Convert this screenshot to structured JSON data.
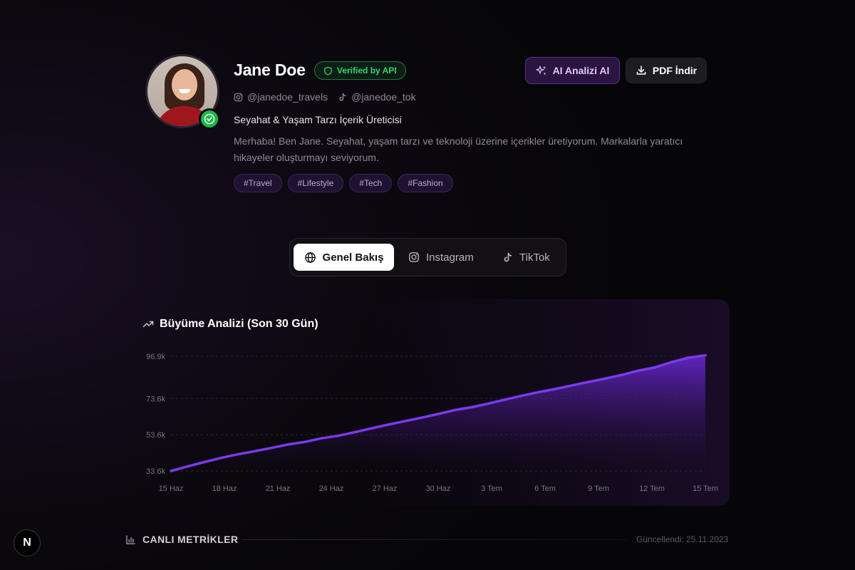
{
  "profile": {
    "name": "Jane Doe",
    "verified_badge": "Verified by API",
    "instagram_handle": "@janedoe_travels",
    "tiktok_handle": "@janedoe_tok",
    "role": "Seyahat & Yaşam Tarzı İçerik Üreticisi",
    "bio": "Merhaba! Ben Jane. Seyahat, yaşam tarzı ve teknoloji üzerine içerikler üretiyorum. Markalarla yaratıcı hikayeler oluşturmayı seviyorum.",
    "tags": [
      "#Travel",
      "#Lifestyle",
      "#Tech",
      "#Fashion"
    ]
  },
  "actions": {
    "ai_label": "AI Analizi Al",
    "pdf_label": "PDF İndir"
  },
  "tabs": [
    {
      "label": "Genel Bakış",
      "icon": "globe-icon",
      "active": true
    },
    {
      "label": "Instagram",
      "icon": "instagram-icon",
      "active": false
    },
    {
      "label": "TikTok",
      "icon": "tiktok-icon",
      "active": false
    }
  ],
  "growth": {
    "title": "Büyüme Analizi (Son 30 Gün)"
  },
  "chart_data": {
    "type": "area",
    "title": "Büyüme Analizi (Son 30 Gün)",
    "x_ticks": [
      "15 Haz",
      "18 Haz",
      "21 Haz",
      "24 Haz",
      "27 Haz",
      "30 Haz",
      "3 Tem",
      "6 Tem",
      "9 Tem",
      "12 Tem",
      "15 Tem"
    ],
    "y_ticks": [
      "33.6k",
      "53.6k",
      "73.6k",
      "96.9k"
    ],
    "y_tick_values": [
      33600,
      53600,
      73600,
      96900
    ],
    "ylim": [
      33600,
      96900
    ],
    "series": [
      {
        "values": [
          33600,
          36100,
          38500,
          40800,
          42800,
          44500,
          46300,
          48200,
          49600,
          51600,
          53000,
          55000,
          57100,
          59200,
          61100,
          63000,
          65000,
          67200,
          68800,
          70800,
          73000,
          75100,
          77100,
          78800,
          80800,
          82700,
          84600,
          86600,
          89000,
          90800,
          93700,
          96100,
          97400
        ]
      }
    ],
    "grid": true,
    "line_color": "#7c3aed",
    "fill_color": "#6d28d9"
  },
  "metrics": {
    "title": "CANLI METRİKLER",
    "updated": "Güncellendi: 25.11.2023"
  },
  "badge": {
    "letter": "N"
  },
  "colors": {
    "accent_purple": "#7c3aed",
    "verified_green": "#37d46f",
    "background": "#0c0910"
  }
}
